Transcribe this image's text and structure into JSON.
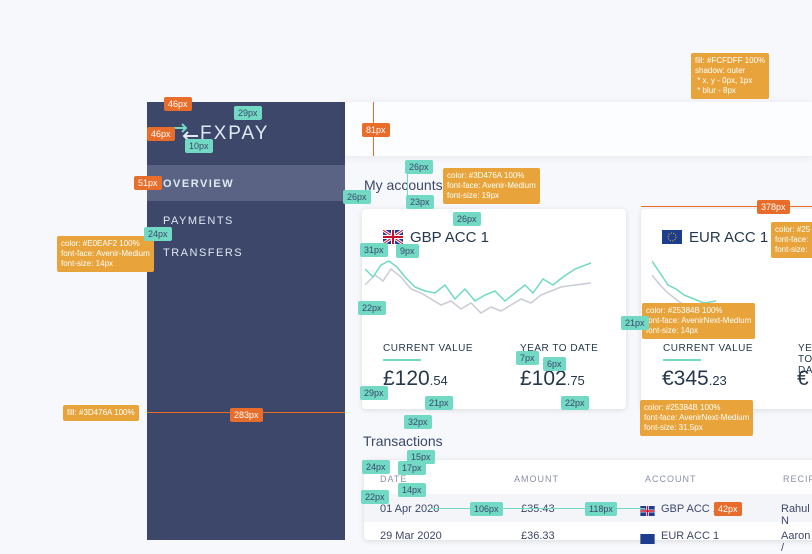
{
  "brand": {
    "logo_text": "FXPAY"
  },
  "nav": {
    "items": [
      "OVERVIEW",
      "PAYMENTS",
      "TRANSFERS"
    ]
  },
  "main": {
    "section_title": "My accounts",
    "transactions_title": "Transactions"
  },
  "accounts": [
    {
      "name": "GBP ACC 1",
      "current_label": "CURRENT VALUE",
      "current_main": "£120",
      "current_dec": ".54",
      "ytd_label": "YEAR TO DATE",
      "ytd_main": "£102",
      "ytd_dec": ".75"
    },
    {
      "name": "EUR ACC 1",
      "current_label": "CURRENT VALUE",
      "current_main": "€345",
      "current_dec": ".23",
      "ytd_label": "YEAR TO DATE",
      "ytd_main": "€",
      "ytd_dec": ""
    }
  ],
  "table": {
    "headers": [
      "DATE",
      "AMOUNT",
      "ACCOUNT",
      "RECIPI"
    ],
    "rows": [
      {
        "date": "01 Apr 2020",
        "amount": "£35.43",
        "account": "GBP ACC 1",
        "recipient": "Rahul N"
      },
      {
        "date": "29 Mar 2020",
        "amount": "£36.33",
        "account": "EUR ACC 1",
        "recipient": "Aaron /"
      }
    ]
  },
  "annotations": {
    "shadow_spec": "fill: #FCFDFF 100%\nshadow: outer\n * x, y - 0px, 1px\n * blur - 8px",
    "accounts_font": "color: #3D476A 100%\nfont-face: Avenir-Medium\nfont-size: 19px",
    "nav_font": "color: #E0EAF2 100%\nfont-face: Avenir-Medium\nfont-size: 14px",
    "label_font": "color: #25384B 100%\nfont-face: AvenirNext-Medium\nfont-size: 14px",
    "value_font": "color: #25384B 100%\nfont-face: AvenirNext-Medium\nfont-size: 31.5px",
    "sidebar_fill": "fill: #3D476A 100%",
    "right_clip_1": "color: #25",
    "right_clip_2": "font-face:",
    "right_clip_3": "font-size:",
    "dims": {
      "d46a": "46px",
      "d29": "29px",
      "d46b": "46px",
      "d10": "10px",
      "d81": "81px",
      "d51": "51px",
      "d26a": "26px",
      "d26b": "26px",
      "d23": "23px",
      "d26c": "26px",
      "d24a": "24px",
      "d31": "31px",
      "d9": "9px",
      "d22a": "22px",
      "d21a": "21px",
      "d7": "7px",
      "d6": "6px",
      "d29b": "29px",
      "d21b": "21px",
      "d22b": "22px",
      "d32": "32px",
      "d283": "283px",
      "d378": "378px",
      "d15": "15px",
      "d24b": "24px",
      "d17": "17px",
      "d14": "14px",
      "d22c": "22px",
      "d106": "106px",
      "d118": "118px",
      "d42": "42px"
    }
  },
  "colors": {
    "sidebar": "#3D476A",
    "topbar": "#FCFDFF",
    "accent_green": "#71D9C4",
    "accent_orange": "#E96D2A",
    "note_yellow": "#E8A43A"
  }
}
